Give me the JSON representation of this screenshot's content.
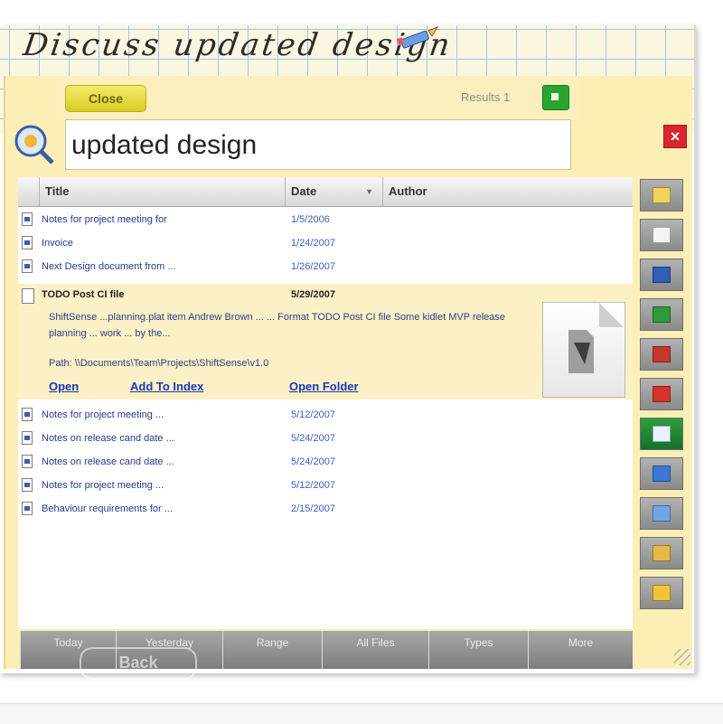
{
  "window_title": "Discuss updated design",
  "tag_button_label": "Close",
  "results_label": "Results 1",
  "search": {
    "value": "updated design"
  },
  "columns": {
    "title": "Title",
    "date": "Date",
    "author": "Author"
  },
  "rows_before": [
    {
      "title": "Notes for project meeting for",
      "date": "1/5/2006"
    },
    {
      "title": "Invoice",
      "date": "1/24/2007"
    },
    {
      "title": "Next Design document from ...",
      "date": "1/26/2007"
    }
  ],
  "expanded": {
    "title": "TODO Post CI file",
    "date": "5/29/2007",
    "snippet": "ShiftSense  ...planning.plat item Andrew Brown ... ... Format TODO Post CI file Some kidlet MVP release planning  ...  work  ... by the...",
    "path": "Path: \\\\Documents\\Team\\Projects\\ShiftSense\\v1.0",
    "links": {
      "open": "Open",
      "add_to_index": "Add To Index",
      "open_folder": "Open Folder"
    }
  },
  "rows_after": [
    {
      "title": "Notes for project meeting ... ",
      "date": "5/12/2007"
    },
    {
      "title": "Notes on release cand date ...",
      "date": "5/24/2007"
    },
    {
      "title": "Notes on release cand date ...",
      "date": "5/24/2007"
    },
    {
      "title": "Notes for project meeting ... ",
      "date": "5/12/2007"
    },
    {
      "title": "Behaviour requirements for  ... ",
      "date": "2/15/2007"
    }
  ],
  "toolbar_icons": [
    {
      "name": "email-icon",
      "color": "#f1d35c"
    },
    {
      "name": "calendar-icon",
      "color": "#f4f4f4"
    },
    {
      "name": "word-icon",
      "color": "#2f5fb8"
    },
    {
      "name": "excel-icon",
      "color": "#2e9a3a"
    },
    {
      "name": "powerpoint-icon",
      "color": "#c8372d"
    },
    {
      "name": "pdf-icon",
      "color": "#d73227"
    },
    {
      "name": "onenote-icon",
      "color": "#e9f3ff"
    },
    {
      "name": "web-icon",
      "color": "#3b78d6"
    },
    {
      "name": "settings-icon",
      "color": "#6fa6e8"
    },
    {
      "name": "windows-icon",
      "color": "#e8b94a"
    },
    {
      "name": "folder-icon",
      "color": "#f3c33b"
    }
  ],
  "bottom_tabs": [
    "Today",
    "Yesterday",
    "Range",
    "All Files",
    "Types",
    "More"
  ],
  "back_label": "Back"
}
